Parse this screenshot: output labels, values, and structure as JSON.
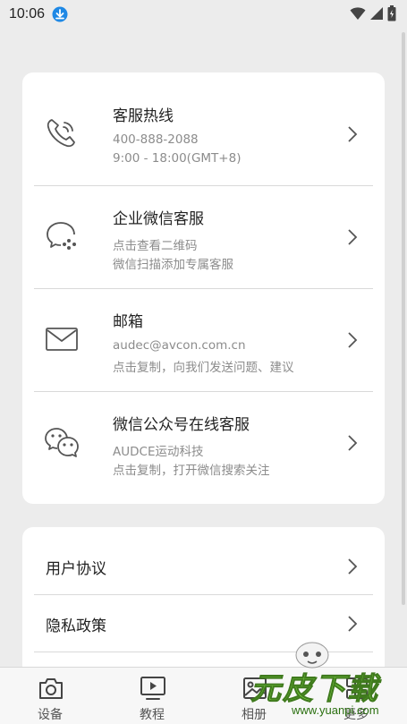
{
  "status_bar": {
    "time": "10:06"
  },
  "contacts": [
    {
      "title": "客服热线",
      "line1": "400-888-2088",
      "line2": "9:00 - 18:00(GMT+8)",
      "icon": "phone-icon"
    },
    {
      "title": "企业微信客服",
      "line1": "点击查看二维码",
      "line2": "微信扫描添加专属客服",
      "icon": "wecom-icon"
    },
    {
      "title": "邮箱",
      "line1": "audec@avcon.com.cn",
      "line2": "点击复制，向我们发送问题、建议",
      "icon": "mail-icon"
    },
    {
      "title": "微信公众号在线客服",
      "line1": "AUDCE运动科技",
      "line2": "点击复制，打开微信搜索关注",
      "icon": "wechat-icon"
    }
  ],
  "policies": [
    {
      "label": "用户协议"
    },
    {
      "label": "隐私政策"
    }
  ],
  "bottom_nav": [
    {
      "label": "设备",
      "icon": "camera-icon"
    },
    {
      "label": "教程",
      "icon": "play-icon"
    },
    {
      "label": "相册",
      "icon": "gallery-icon"
    },
    {
      "label": "更多",
      "icon": "more-icon"
    }
  ],
  "watermark": {
    "logo": "元皮下载",
    "url": "www.yuanpi.com"
  },
  "colors": {
    "background": "#ececec",
    "card": "#ffffff",
    "status_accent": "#1e88e5",
    "watermark": "#7bd043"
  }
}
